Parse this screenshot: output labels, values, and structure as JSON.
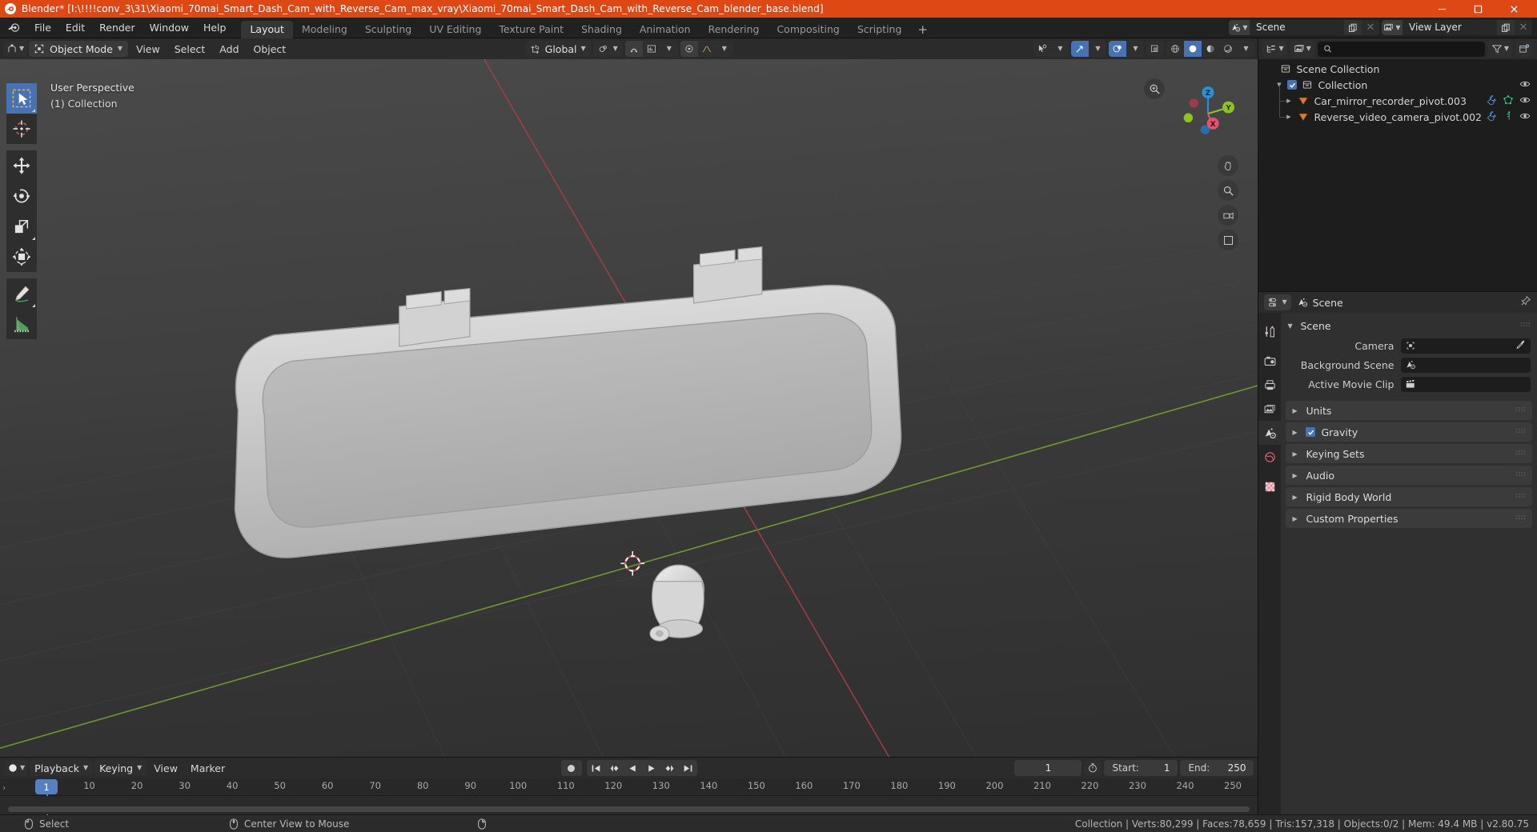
{
  "window": {
    "title": "Blender* [I:\\!!!!conv_3\\31\\Xiaomi_70mai_Smart_Dash_Cam_with_Reverse_Cam_max_vray\\Xiaomi_70mai_Smart_Dash_Cam_with_Reverse_Cam_blender_base.blend]",
    "accent_color": "#dd4814",
    "minimize": "–",
    "maximize": "▢",
    "close": "✕"
  },
  "topbar": {
    "menus": [
      "File",
      "Edit",
      "Render",
      "Window",
      "Help"
    ],
    "workspaces": [
      {
        "label": "Layout",
        "active": true
      },
      {
        "label": "Modeling",
        "active": false
      },
      {
        "label": "Sculpting",
        "active": false
      },
      {
        "label": "UV Editing",
        "active": false
      },
      {
        "label": "Texture Paint",
        "active": false
      },
      {
        "label": "Shading",
        "active": false
      },
      {
        "label": "Animation",
        "active": false
      },
      {
        "label": "Rendering",
        "active": false
      },
      {
        "label": "Compositing",
        "active": false
      },
      {
        "label": "Scripting",
        "active": false
      }
    ],
    "add_workspace": "+",
    "scene_field": {
      "value": "Scene",
      "icon": "scene-icon",
      "copy": "new-scene-icon",
      "unlink": "✕"
    },
    "viewlayer_field": {
      "value": "View Layer",
      "icon": "viewlayer-icon",
      "copy": "new-viewlayer-icon",
      "unlink": "✕"
    }
  },
  "viewport_header": {
    "editor_type": "editor-type-icon",
    "mode": "Object Mode",
    "menus": [
      "View",
      "Select",
      "Add",
      "Object"
    ],
    "transform_orientation": "Global",
    "snap_label": "snap-magnet-icon",
    "proportional_label": "proportional-edit-icon",
    "overlay_caret": "⌄"
  },
  "viewport": {
    "perspective_label": "User Perspective",
    "collection_label": "(1) Collection",
    "gizmo_axes": [
      {
        "label": "X",
        "color": "#e5526b"
      },
      {
        "label": "Y",
        "color": "#8fc31f"
      },
      {
        "label": "Z",
        "color": "#2a8fd8"
      }
    ],
    "tools": [
      {
        "name": "tweak-tool",
        "active": true
      },
      {
        "name": "cursor-tool",
        "active": false
      },
      {
        "name": "move-tool",
        "active": false
      },
      {
        "name": "rotate-tool",
        "active": false
      },
      {
        "name": "scale-tool",
        "active": false
      },
      {
        "name": "transform-tool",
        "active": false
      },
      {
        "name": "annotate-tool",
        "active": false
      },
      {
        "name": "measure-tool",
        "active": false
      }
    ]
  },
  "outliner": {
    "display_mode": "view-layer-icon",
    "filter_icon": "filter-icon",
    "new_collection_icon": "new-collection-icon",
    "search_placeholder": "",
    "search_value": "",
    "rows": [
      {
        "name": "Scene Collection",
        "depth": 0,
        "icon": "collection-icon",
        "expand": "",
        "checkbox": false,
        "visible": false,
        "extra": []
      },
      {
        "name": "Collection",
        "depth": 1,
        "icon": "collection-icon",
        "expand": "▼",
        "checkbox": true,
        "visible": true,
        "extra": []
      },
      {
        "name": "Car_mirror_recorder_pivot.003",
        "depth": 2,
        "icon": "empty-object-icon",
        "expand": "▶",
        "checkbox": false,
        "visible": true,
        "extra": [
          "modifier-icon",
          "mesh-data-icon"
        ]
      },
      {
        "name": "Reverse_video_camera_pivot.002",
        "depth": 2,
        "icon": "empty-object-icon",
        "expand": "▶",
        "checkbox": false,
        "visible": true,
        "extra": [
          "modifier-icon",
          "empty-data-icon"
        ]
      }
    ]
  },
  "properties": {
    "breadcrumb": "Scene",
    "breadcrumb_icon": "scene-icon",
    "pin_icon": "pin-icon",
    "tabs": [
      {
        "name": "tool-tab",
        "active": false
      },
      {
        "name": "render-tab",
        "active": false
      },
      {
        "name": "output-tab",
        "active": false
      },
      {
        "name": "view-layer-tab",
        "active": false
      },
      {
        "name": "scene-tab",
        "active": true
      },
      {
        "name": "world-tab",
        "active": false
      },
      {
        "name": "texture-tab",
        "active": false
      }
    ],
    "scene_panel": {
      "title": "Scene",
      "expanded": true,
      "fields": [
        {
          "label": "Camera",
          "value": "",
          "icon": "camera-object-icon",
          "has_eyedropper": true
        },
        {
          "label": "Background Scene",
          "value": "",
          "icon": "scene-icon",
          "has_eyedropper": false
        },
        {
          "label": "Active Movie Clip",
          "value": "",
          "icon": "movie-clip-icon",
          "has_eyedropper": false
        }
      ]
    },
    "panels": [
      {
        "title": "Units",
        "expanded": false,
        "checkbox": null
      },
      {
        "title": "Gravity",
        "expanded": false,
        "checkbox": true
      },
      {
        "title": "Keying Sets",
        "expanded": false,
        "checkbox": null
      },
      {
        "title": "Audio",
        "expanded": false,
        "checkbox": null
      },
      {
        "title": "Rigid Body World",
        "expanded": false,
        "checkbox": null
      },
      {
        "title": "Custom Properties",
        "expanded": false,
        "checkbox": null
      }
    ]
  },
  "timeline": {
    "editor_icon": "timeline-editor-icon",
    "menus": [
      {
        "label": "Playback",
        "dropdown": true
      },
      {
        "label": "Keying",
        "dropdown": true
      },
      {
        "label": "View",
        "dropdown": false
      },
      {
        "label": "Marker",
        "dropdown": false
      }
    ],
    "playback_buttons": [
      "record",
      "jump-start",
      "prev-keyframe",
      "play-reverse",
      "play",
      "next-keyframe",
      "jump-end"
    ],
    "current_frame": "1",
    "use_preview_range_icon": "stopwatch-icon",
    "start_label": "Start:",
    "start_value": "1",
    "end_label": "End:",
    "end_value": "250",
    "ruler_ticks": [
      1,
      10,
      20,
      30,
      40,
      50,
      60,
      70,
      80,
      90,
      100,
      110,
      120,
      130,
      140,
      150,
      160,
      170,
      180,
      190,
      200,
      210,
      220,
      230,
      240,
      250
    ],
    "playhead_frame": 1,
    "playhead_color": "#5680c2"
  },
  "statusbar": {
    "hints": [
      {
        "icon": "mouse-left-icon",
        "label": "Select"
      },
      {
        "icon": "mouse-middle-icon",
        "label": "Center View to Mouse"
      },
      {
        "icon": "mouse-right-icon",
        "label": ""
      }
    ],
    "stats": "Collection | Verts:80,299 | Faces:78,659 | Tris:157,318 | Objects:0/2 | Mem: 49.4 MB | v2.80.75"
  }
}
